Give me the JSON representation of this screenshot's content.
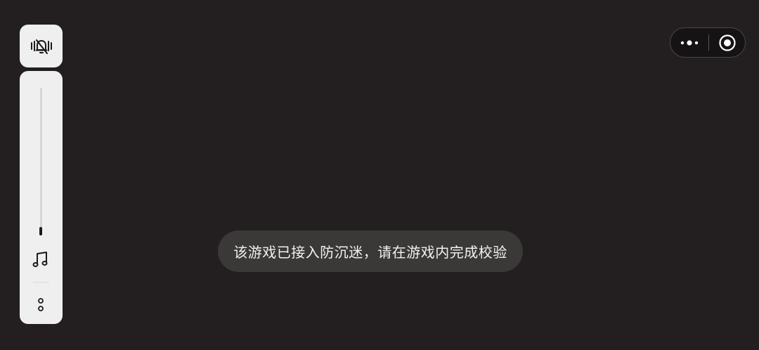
{
  "left_controls": {
    "silent_icon": "bell-off-vibrate-icon",
    "volume_level": 0.05,
    "music_icon": "music-note-icon",
    "more_icon": "more-vertical-icon"
  },
  "capsule": {
    "more_icon": "more-horizontal-icon",
    "close_icon": "target-close-icon"
  },
  "toast": {
    "message": "该游戏已接入防沉迷，请在游戏内完成校验"
  }
}
